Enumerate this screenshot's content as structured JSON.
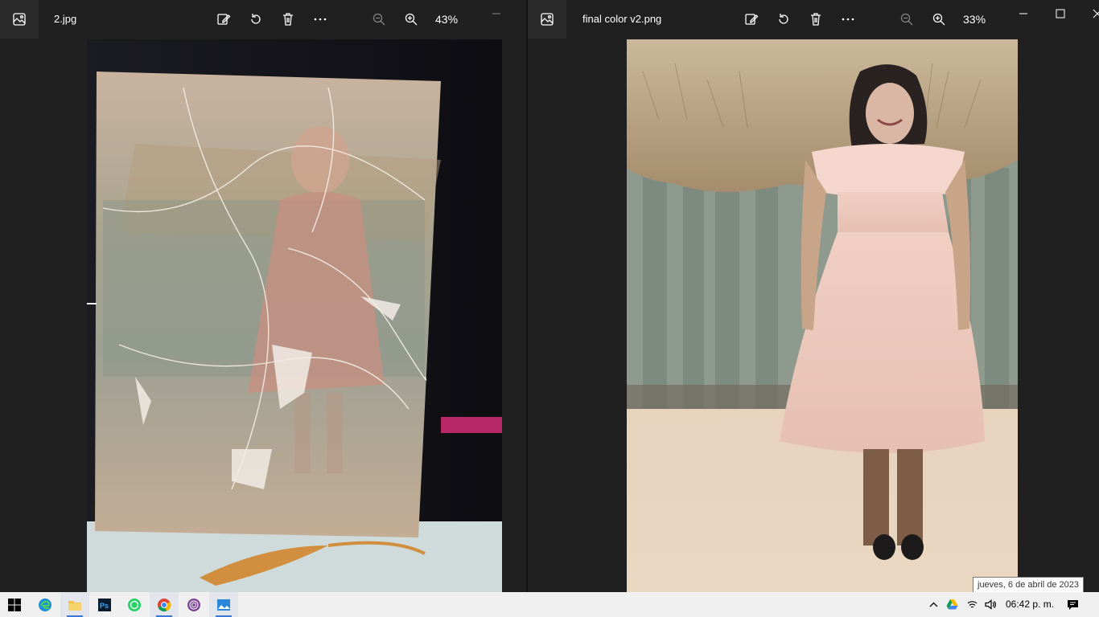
{
  "left_window": {
    "filename": "2.jpg",
    "zoom": "43%",
    "icons": [
      "photos-app-icon",
      "edit-icon",
      "rotate-icon",
      "delete-icon",
      "more-icon",
      "zoom-out-icon",
      "zoom-in-icon"
    ]
  },
  "right_window": {
    "filename": "final color v2.png",
    "zoom": "33%",
    "icons": [
      "photos-app-icon",
      "edit-icon",
      "rotate-icon",
      "delete-icon",
      "more-icon",
      "zoom-out-icon",
      "zoom-in-icon",
      "minimize-icon",
      "maximize-icon",
      "close-icon"
    ]
  },
  "taskbar": {
    "apps": [
      "start-icon",
      "edge-icon",
      "file-explorer-icon",
      "photoshop-icon",
      "whatsapp-icon",
      "chrome-icon",
      "tor-icon",
      "photos-icon"
    ],
    "photoshop_glyph": "Ps",
    "clock": "06:42 p. m.",
    "tray": [
      "chevron-up-icon",
      "google-drive-icon",
      "wifi-icon",
      "volume-icon",
      "notification-icon"
    ]
  },
  "tooltip": {
    "date": "jueves, 6 de abril de 2023"
  },
  "colors": {
    "titlebar": "#202020",
    "taskbar": "#f0f0f0",
    "accent": "#3a78d4"
  }
}
